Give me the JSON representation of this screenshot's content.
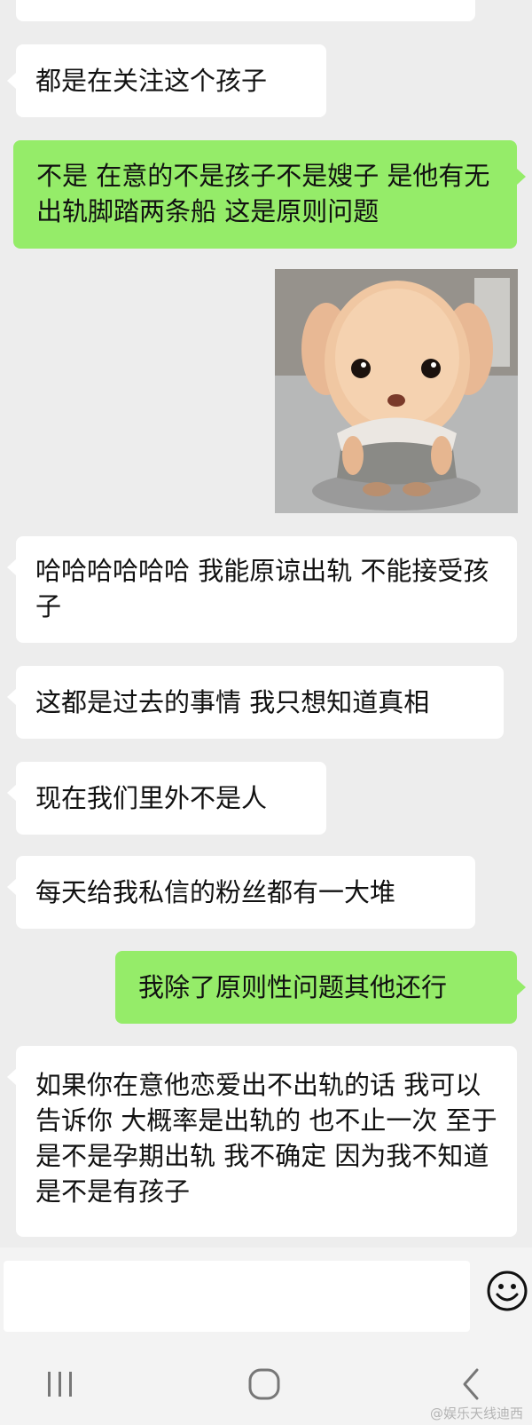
{
  "messages": [
    {
      "side": "left",
      "text": "都是在关注这个孩子"
    },
    {
      "side": "right",
      "text": "不是 在意的不是孩子不是嫂子 是他有无出轨脚踏两条船 这是原则问题"
    },
    {
      "side": "right",
      "type": "sticker",
      "sticker": "plush-puppy-sticker"
    },
    {
      "side": "left",
      "text": "哈哈哈哈哈哈 我能原谅出轨 不能接受孩子"
    },
    {
      "side": "left",
      "text": "这都是过去的事情 我只想知道真相"
    },
    {
      "side": "left",
      "text": "现在我们里外不是人"
    },
    {
      "side": "left",
      "text": "每天给我私信的粉丝都有一大堆"
    },
    {
      "side": "right",
      "text": "我除了原则性问题其他还行"
    },
    {
      "side": "left",
      "text": "如果你在意他恋爱出不出轨的话 我可以告诉你 大概率是出轨的 也不止一次 至于是不是孕期出轨 我不确定 因为我不知道是不是有孩子"
    }
  ],
  "input": {
    "value": "",
    "emoji_icon": "smiley-face-icon"
  },
  "navbar": {
    "recent_icon": "recent-apps-icon",
    "home_icon": "home-icon",
    "back_icon": "back-icon"
  },
  "watermark": "@娱乐天线迪西",
  "colors": {
    "background": "#ededed",
    "incoming": "#ffffff",
    "outgoing": "#95ec69"
  }
}
